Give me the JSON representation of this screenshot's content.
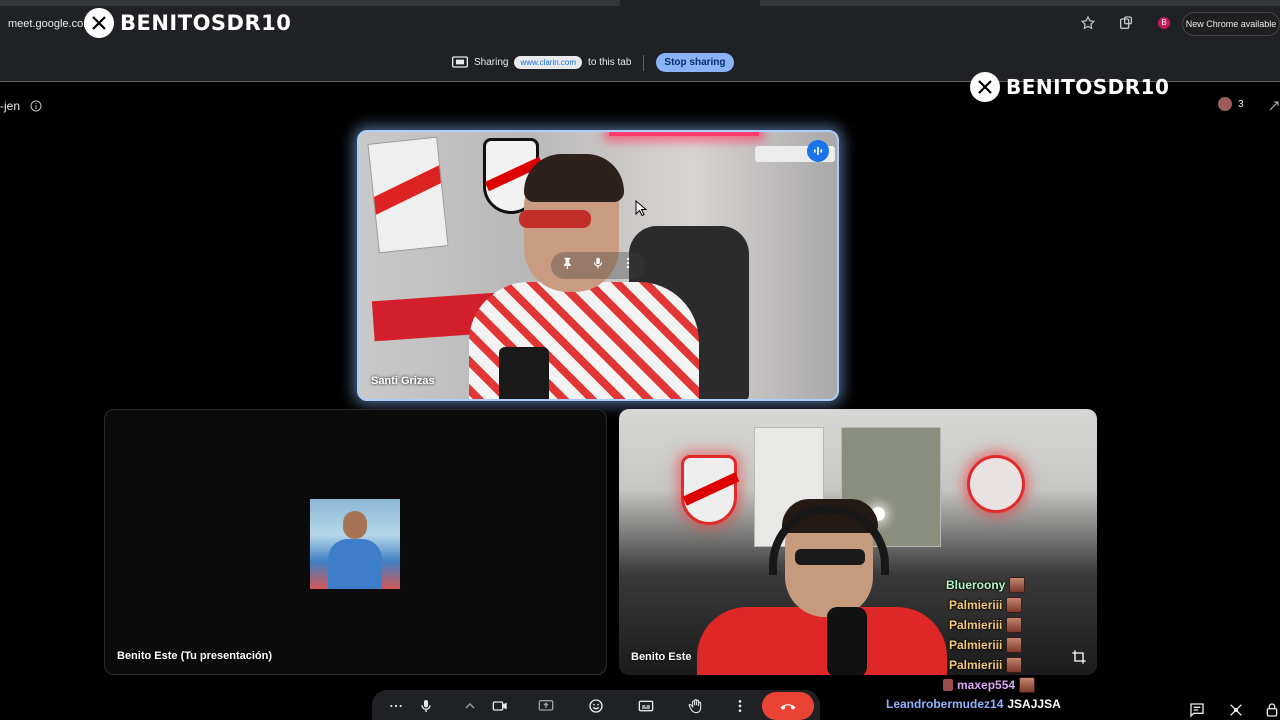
{
  "browser": {
    "url": "meet.google.com",
    "update_label": "New Chrome available",
    "profile_initial": "B"
  },
  "watermark": {
    "handle": "BENITOSDR10"
  },
  "share_bar": {
    "sharing_label": "Sharing",
    "site": "www.clarin.com",
    "to_tab_label": "to this tab",
    "stop_label": "Stop sharing"
  },
  "meet": {
    "code_fragment": "-jen",
    "participant_count": "3"
  },
  "tiles": {
    "main_speaker": "Santi Grizas",
    "presentation": "Benito Este (Tu presentación)",
    "self": "Benito Este"
  },
  "chat": [
    {
      "name": "Blueroony",
      "color": "#b7f5c8",
      "message": ""
    },
    {
      "name": "Palmieriii",
      "color": "#f4c97a",
      "message": ""
    },
    {
      "name": "Palmieriii",
      "color": "#f4c97a",
      "message": ""
    },
    {
      "name": "Palmieriii",
      "color": "#f4c97a",
      "message": ""
    },
    {
      "name": "Palmieriii",
      "color": "#f4c97a",
      "message": ""
    },
    {
      "name": "maxep554",
      "color": "#d7a7f2",
      "message": ""
    },
    {
      "name": "Leandrobermudez14",
      "color": "#8fb4ff",
      "message": "JSAJJSA"
    }
  ],
  "icons": {
    "star": "bookmark-star-icon",
    "extensions": "puzzle-icon",
    "present": "present-screen-icon",
    "info": "info-icon",
    "speaking": "speaking-indicator-icon",
    "pin": "pin-icon",
    "mic": "mic-icon",
    "more": "more-vert-icon",
    "crop": "crop-icon",
    "camera": "camera-icon",
    "emoji": "emoji-icon",
    "captions": "captions-icon",
    "hand": "raise-hand-icon",
    "end_call": "end-call-icon",
    "chat": "chat-icon",
    "activities": "activities-icon",
    "lock": "lock-icon"
  },
  "colors": {
    "accent": "#8ab4f8",
    "end_call": "#ea4335",
    "surface": "#202124"
  }
}
